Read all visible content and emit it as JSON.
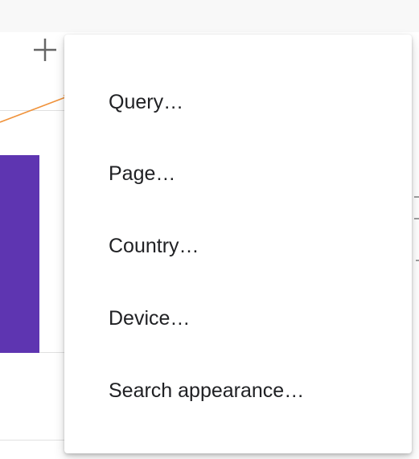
{
  "toolbar": {
    "add_icon": "plus-icon"
  },
  "menu": {
    "items": [
      {
        "label": "Query…"
      },
      {
        "label": "Page…"
      },
      {
        "label": "Country…"
      },
      {
        "label": "Device…"
      },
      {
        "label": "Search appearance…"
      }
    ]
  },
  "annotation": {
    "arrow_color": "#f0923a"
  },
  "colors": {
    "bar": "#5e35b1",
    "menu_background": "#ffffff",
    "text": "#202124"
  }
}
